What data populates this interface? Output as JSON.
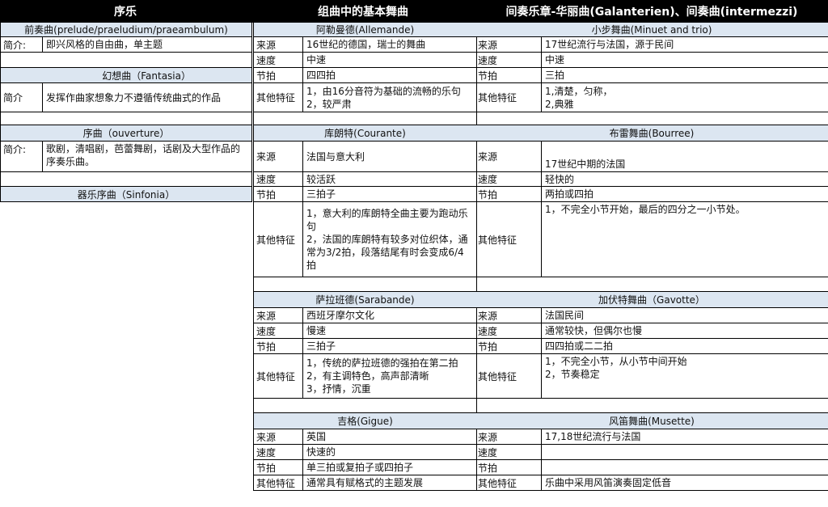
{
  "headers": {
    "left": "序乐",
    "middle": "组曲中的基本舞曲",
    "right": "间奏乐章-华丽曲(Galanterien)、间奏曲(intermezzi)"
  },
  "left": {
    "prelude_title": "前奏曲(prelude/praeludium/praeambulum)",
    "prelude_label": "简介:",
    "prelude_text": "即兴风格的自由曲，单主题",
    "fantasia_title": "幻想曲（Fantasia）",
    "fantasia_label": "简介",
    "fantasia_text": "发挥作曲家想象力不遵循传统曲式的作品",
    "overture_title": "序曲（ouverture）",
    "overture_label": "简介:",
    "overture_text": "歌剧，清唱剧，芭蕾舞剧，话剧及大型作品的序奏乐曲。",
    "sinfonia_title": "器乐序曲（Sinfonia）"
  },
  "middle": {
    "allemande": {
      "title": "阿勒曼德(Allemande)",
      "source_label": "来源",
      "source": "16世纪的德国，瑞士的舞曲",
      "tempo_label": "速度",
      "tempo": "中速",
      "meter_label": "节拍",
      "meter": "四四拍",
      "other_label": "其他特征",
      "other": "1，由16分音符为基础的流畅的乐句\n2，较严肃"
    },
    "courante": {
      "title": "库朗特(Courante)",
      "source_label": "来源",
      "source": "法国与意大利",
      "tempo_label": "速度",
      "tempo": "较活跃",
      "meter_label": "节拍",
      "meter": "三拍子",
      "other_label": "其他特征",
      "other": "1，意大利的库朗特全曲主要为跑动乐句\n2，法国的库朗特有较多对位织体，通常为3/2拍，段落结尾有时会变成6/4拍"
    },
    "sarabande": {
      "title": "萨拉班德(Sarabande)",
      "source_label": "来源",
      "source": "西班牙摩尔文化",
      "tempo_label": "速度",
      "tempo": "慢速",
      "meter_label": "节拍",
      "meter": "三拍子",
      "other_label": "其他特征",
      "other": "1，传统的萨拉班德的强拍在第二拍\n2，有主调特色，高声部清晰\n3，抒情，沉重"
    },
    "gigue": {
      "title": "吉格(Gigue)",
      "source_label": "来源",
      "source": "英国",
      "tempo_label": "速度",
      "tempo": "快速的",
      "meter_label": "节拍",
      "meter": "单三拍或复拍子或四拍子",
      "other_label": "其他特征",
      "other": "通常具有赋格式的主题发展"
    }
  },
  "right": {
    "minuet": {
      "title": "小步舞曲(Minuet and trio)",
      "source_label": "来源",
      "source": "17世纪流行与法国，源于民间",
      "tempo_label": "速度",
      "tempo": "中速",
      "meter_label": "节拍",
      "meter": "三拍",
      "other_label": "其他特征",
      "other": "1,清楚，匀称，\n2,典雅"
    },
    "bourree": {
      "title": "布雷舞曲(Bourree)",
      "source_label": "来源",
      "source": "17世纪中期的法国",
      "tempo_label": "速度",
      "tempo": "轻快的",
      "meter_label": "节拍",
      "meter": "两拍或四拍",
      "other_label": "其他特征",
      "other": "1，不完全小节开始，最后的四分之一小节处。"
    },
    "gavotte": {
      "title": "加伏特舞曲（Gavotte）",
      "source_label": "来源",
      "source": "法国民间",
      "tempo_label": "速度",
      "tempo": "通常较快，但偶尔也慢",
      "meter_label": "节拍",
      "meter": "四四拍或二二拍",
      "other_label": "其他特征",
      "other": "1，不完全小节，从小节中间开始\n2，节奏稳定"
    },
    "musette": {
      "title": "风笛舞曲(Musette)",
      "source_label": "来源",
      "source": "17,18世纪流行与法国",
      "tempo_label": "速度",
      "tempo": "",
      "meter_label": "节拍",
      "meter": "",
      "other_label": "其他特征",
      "other": "乐曲中采用风笛演奏固定低音"
    }
  }
}
